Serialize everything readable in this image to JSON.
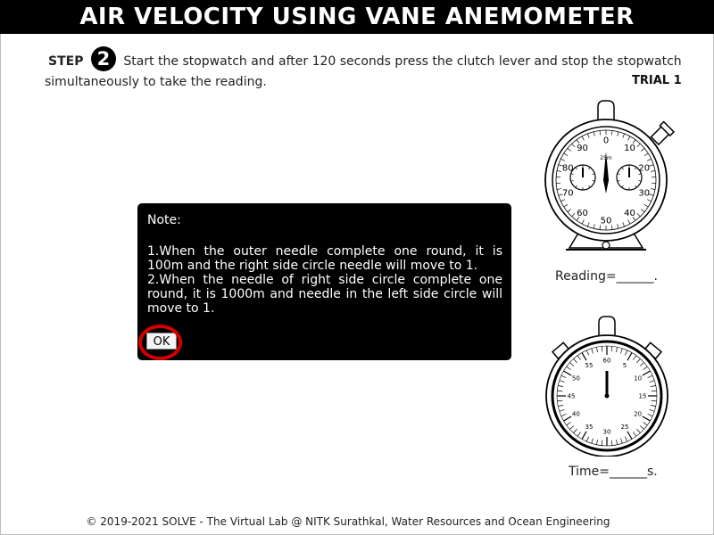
{
  "header": {
    "title": "AIR VELOCITY USING VANE ANEMOMETER"
  },
  "step": {
    "label": "STEP",
    "number": "2",
    "instruction": "Start the stopwatch and after 120 seconds press the clutch lever and stop the stopwatch simultaneously to take the reading."
  },
  "trial": {
    "label": "TRIAL 1"
  },
  "note": {
    "title": "Note:",
    "line1": "1.When the outer needle complete one round, it is 100m and the right side circle needle will move to 1.",
    "line2": "2.When the needle of right side circle complete one round, it is 1000m and needle in the left side circle will move to 1.",
    "ok_label": "OK"
  },
  "anemometer": {
    "dial_numbers": [
      "0",
      "10",
      "20",
      "30",
      "40",
      "50",
      "60",
      "70",
      "80",
      "90"
    ],
    "center_label": "25m",
    "reading_label": "Reading=______."
  },
  "stopwatch": {
    "dial_numbers": [
      "60",
      "5",
      "10",
      "15",
      "20",
      "25",
      "30",
      "35",
      "40",
      "45",
      "50",
      "55"
    ],
    "time_label": "Time=______s."
  },
  "footer": {
    "text": "© 2019-2021 SOLVE - The Virtual Lab @ NITK Surathkal, Water Resources and Ocean Engineering"
  }
}
